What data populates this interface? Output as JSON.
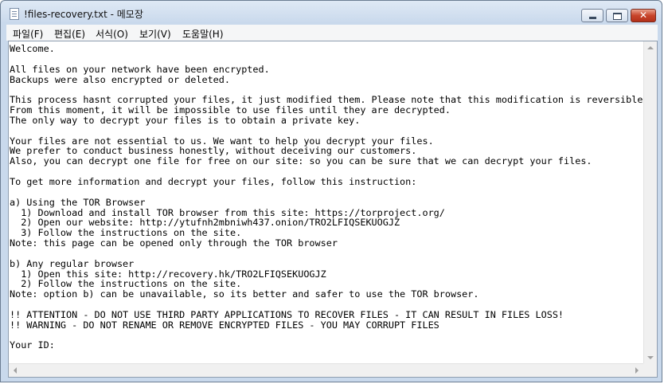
{
  "window": {
    "title": "!files-recovery.txt - 메모장",
    "controls": {
      "close_glyph": "✕"
    }
  },
  "menu": [
    "파일(F)",
    "편집(E)",
    "서식(O)",
    "보기(V)",
    "도움말(H)"
  ],
  "document": {
    "lines": [
      "Welcome.",
      "",
      "All files on your network have been encrypted.",
      "Backups were also encrypted or deleted.",
      "",
      "This process hasnt corrupted your files, it just modified them. Please note that this modification is reversible.",
      "From this moment, it will be impossible to use files until they are decrypted.",
      "The only way to decrypt your files is to obtain a private key.",
      "",
      "Your files are not essential to us. We want to help you decrypt your files.",
      "We prefer to conduct business honestly, without deceiving our customers.",
      "Also, you can decrypt one file for free on our site: so you can be sure that we can decrypt your files.",
      "",
      "To get more information and decrypt your files, follow this instruction:",
      "",
      "a) Using the TOR Browser",
      "  1) Download and install TOR browser from this site: https://torproject.org/",
      "  2) Open our website: http://ytufnh2mbniwh437.onion/TRO2LFIQSEKUOGJZ",
      "  3) Follow the instructions on the site.",
      "Note: this page can be opened only through the TOR browser",
      "",
      "b) Any regular browser",
      "  1) Open this site: http://recovery.hk/TRO2LFIQSEKUOGJZ",
      "  2) Follow the instructions on the site.",
      "Note: option b) can be unavailable, so its better and safer to use the TOR browser.",
      "",
      "!! ATTENTION - DO NOT USE THIRD PARTY APPLICATIONS TO RECOVER FILES - IT CAN RESULT IN FILES LOSS!",
      "!! WARNING - DO NOT RENAME OR REMOVE ENCRYPTED FILES - YOU MAY CORRUPT FILES",
      "",
      "Your ID:"
    ]
  }
}
